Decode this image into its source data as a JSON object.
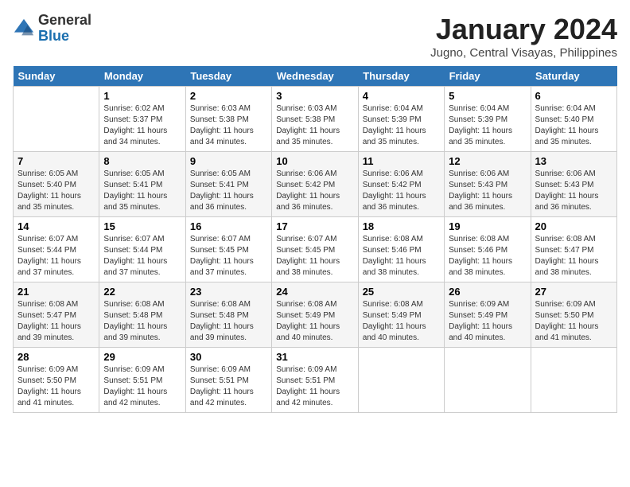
{
  "header": {
    "logo": {
      "line1": "General",
      "line2": "Blue"
    },
    "title": "January 2024",
    "subtitle": "Jugno, Central Visayas, Philippines"
  },
  "weekdays": [
    "Sunday",
    "Monday",
    "Tuesday",
    "Wednesday",
    "Thursday",
    "Friday",
    "Saturday"
  ],
  "weeks": [
    [
      {
        "day": "",
        "info": ""
      },
      {
        "day": "1",
        "info": "Sunrise: 6:02 AM\nSunset: 5:37 PM\nDaylight: 11 hours\nand 34 minutes."
      },
      {
        "day": "2",
        "info": "Sunrise: 6:03 AM\nSunset: 5:38 PM\nDaylight: 11 hours\nand 34 minutes."
      },
      {
        "day": "3",
        "info": "Sunrise: 6:03 AM\nSunset: 5:38 PM\nDaylight: 11 hours\nand 35 minutes."
      },
      {
        "day": "4",
        "info": "Sunrise: 6:04 AM\nSunset: 5:39 PM\nDaylight: 11 hours\nand 35 minutes."
      },
      {
        "day": "5",
        "info": "Sunrise: 6:04 AM\nSunset: 5:39 PM\nDaylight: 11 hours\nand 35 minutes."
      },
      {
        "day": "6",
        "info": "Sunrise: 6:04 AM\nSunset: 5:40 PM\nDaylight: 11 hours\nand 35 minutes."
      }
    ],
    [
      {
        "day": "7",
        "info": "Sunrise: 6:05 AM\nSunset: 5:40 PM\nDaylight: 11 hours\nand 35 minutes."
      },
      {
        "day": "8",
        "info": "Sunrise: 6:05 AM\nSunset: 5:41 PM\nDaylight: 11 hours\nand 35 minutes."
      },
      {
        "day": "9",
        "info": "Sunrise: 6:05 AM\nSunset: 5:41 PM\nDaylight: 11 hours\nand 36 minutes."
      },
      {
        "day": "10",
        "info": "Sunrise: 6:06 AM\nSunset: 5:42 PM\nDaylight: 11 hours\nand 36 minutes."
      },
      {
        "day": "11",
        "info": "Sunrise: 6:06 AM\nSunset: 5:42 PM\nDaylight: 11 hours\nand 36 minutes."
      },
      {
        "day": "12",
        "info": "Sunrise: 6:06 AM\nSunset: 5:43 PM\nDaylight: 11 hours\nand 36 minutes."
      },
      {
        "day": "13",
        "info": "Sunrise: 6:06 AM\nSunset: 5:43 PM\nDaylight: 11 hours\nand 36 minutes."
      }
    ],
    [
      {
        "day": "14",
        "info": "Sunrise: 6:07 AM\nSunset: 5:44 PM\nDaylight: 11 hours\nand 37 minutes."
      },
      {
        "day": "15",
        "info": "Sunrise: 6:07 AM\nSunset: 5:44 PM\nDaylight: 11 hours\nand 37 minutes."
      },
      {
        "day": "16",
        "info": "Sunrise: 6:07 AM\nSunset: 5:45 PM\nDaylight: 11 hours\nand 37 minutes."
      },
      {
        "day": "17",
        "info": "Sunrise: 6:07 AM\nSunset: 5:45 PM\nDaylight: 11 hours\nand 38 minutes."
      },
      {
        "day": "18",
        "info": "Sunrise: 6:08 AM\nSunset: 5:46 PM\nDaylight: 11 hours\nand 38 minutes."
      },
      {
        "day": "19",
        "info": "Sunrise: 6:08 AM\nSunset: 5:46 PM\nDaylight: 11 hours\nand 38 minutes."
      },
      {
        "day": "20",
        "info": "Sunrise: 6:08 AM\nSunset: 5:47 PM\nDaylight: 11 hours\nand 38 minutes."
      }
    ],
    [
      {
        "day": "21",
        "info": "Sunrise: 6:08 AM\nSunset: 5:47 PM\nDaylight: 11 hours\nand 39 minutes."
      },
      {
        "day": "22",
        "info": "Sunrise: 6:08 AM\nSunset: 5:48 PM\nDaylight: 11 hours\nand 39 minutes."
      },
      {
        "day": "23",
        "info": "Sunrise: 6:08 AM\nSunset: 5:48 PM\nDaylight: 11 hours\nand 39 minutes."
      },
      {
        "day": "24",
        "info": "Sunrise: 6:08 AM\nSunset: 5:49 PM\nDaylight: 11 hours\nand 40 minutes."
      },
      {
        "day": "25",
        "info": "Sunrise: 6:08 AM\nSunset: 5:49 PM\nDaylight: 11 hours\nand 40 minutes."
      },
      {
        "day": "26",
        "info": "Sunrise: 6:09 AM\nSunset: 5:49 PM\nDaylight: 11 hours\nand 40 minutes."
      },
      {
        "day": "27",
        "info": "Sunrise: 6:09 AM\nSunset: 5:50 PM\nDaylight: 11 hours\nand 41 minutes."
      }
    ],
    [
      {
        "day": "28",
        "info": "Sunrise: 6:09 AM\nSunset: 5:50 PM\nDaylight: 11 hours\nand 41 minutes."
      },
      {
        "day": "29",
        "info": "Sunrise: 6:09 AM\nSunset: 5:51 PM\nDaylight: 11 hours\nand 42 minutes."
      },
      {
        "day": "30",
        "info": "Sunrise: 6:09 AM\nSunset: 5:51 PM\nDaylight: 11 hours\nand 42 minutes."
      },
      {
        "day": "31",
        "info": "Sunrise: 6:09 AM\nSunset: 5:51 PM\nDaylight: 11 hours\nand 42 minutes."
      },
      {
        "day": "",
        "info": ""
      },
      {
        "day": "",
        "info": ""
      },
      {
        "day": "",
        "info": ""
      }
    ]
  ]
}
